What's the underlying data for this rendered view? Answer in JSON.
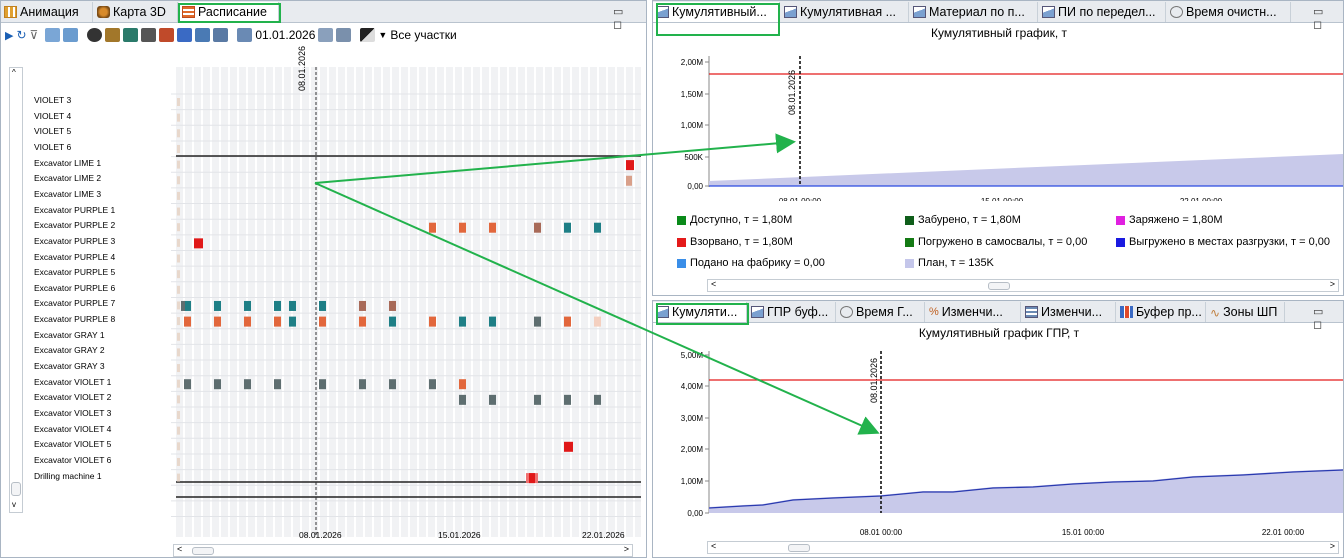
{
  "left_pane": {
    "tabs": [
      {
        "label": "Анимация",
        "icon": "animation-icon"
      },
      {
        "label": "Карта 3D",
        "icon": "map-3d-icon"
      },
      {
        "label": "Расписание",
        "icon": "schedule-icon"
      }
    ],
    "toolbar": {
      "date": "01.01.2026",
      "area_select": "Все участки"
    },
    "rows": [
      "VIOLET 3",
      "VIOLET 4",
      "VIOLET 5",
      "VIOLET 6",
      "Excavator LIME 1",
      "Excavator LIME 2",
      "Excavator LIME 3",
      "Excavator PURPLE 1",
      "Excavator PURPLE 2",
      "Excavator PURPLE 3",
      "Excavator PURPLE 4",
      "Excavator PURPLE 5",
      "Excavator PURPLE 6",
      "Excavator PURPLE 7",
      "Excavator PURPLE 8",
      "Excavator GRAY 1",
      "Excavator GRAY 2",
      "Excavator GRAY 3",
      "Excavator VIOLET 1",
      "Excavator VIOLET  2",
      "Excavator VIOLET  3",
      "Excavator VIOLET  4",
      "Excavator VIOLET  5",
      "Excavator VIOLET  6",
      "Drilling machine 1"
    ],
    "marker_date": "08.01.2026",
    "x_ticks": [
      "08.01.2026",
      "15.01.2026",
      "22.01.2026"
    ]
  },
  "top_right": {
    "tabs": [
      {
        "label": "Кумулятивный...",
        "icon": "area-chart-icon"
      },
      {
        "label": "Кумулятивная ...",
        "icon": "area-chart-icon"
      },
      {
        "label": "Материал по п...",
        "icon": "area-chart-icon"
      },
      {
        "label": "ПИ по передел...",
        "icon": "area-chart-icon"
      },
      {
        "label": "Время очистн...",
        "icon": "gauge-icon"
      }
    ],
    "title": "Кумулятивный график, т",
    "marker_date": "08.01.2026",
    "y_ticks": [
      "2,00M",
      "1,50M",
      "1,00M",
      "500K",
      "0,00"
    ],
    "x_ticks": [
      "08.01 00:00",
      "15.01 00:00",
      "22.01 00:00"
    ],
    "legend": [
      {
        "label": "Доступно, т = 1,80M",
        "color": "#0a8a1a"
      },
      {
        "label": "Забурено, т = 1,80M",
        "color": "#0f5e1a"
      },
      {
        "label": "Заряжено = 1,80M",
        "color": "#e020e0"
      },
      {
        "label": "Взорвано, т = 1,80M",
        "color": "#e41a1a"
      },
      {
        "label": "Погружено в самосвалы, т = 0,00",
        "color": "#147a14"
      },
      {
        "label": "Выгружено в местах разгрузки, т = 0,00",
        "color": "#1a1ae0"
      },
      {
        "label": "Подано на фабрику = 0,00",
        "color": "#3a8ee8"
      },
      {
        "label": "План, т = 135K",
        "color": "#c4c6ea"
      }
    ]
  },
  "bottom_right": {
    "tabs": [
      {
        "label": "Кумуляти...",
        "icon": "area-chart-icon"
      },
      {
        "label": "ГПР буф...",
        "icon": "area-chart-icon"
      },
      {
        "label": "Время Г...",
        "icon": "gauge-icon"
      },
      {
        "label": "Изменчи...",
        "icon": "percent-icon"
      },
      {
        "label": "Изменчи...",
        "icon": "table-icon"
      },
      {
        "label": "Буфер пр...",
        "icon": "bar-chart-icon"
      },
      {
        "label": "Зоны ШП",
        "icon": "line-icon"
      }
    ],
    "title": "Кумулятивный график ГПР, т",
    "marker_date": "08.01.2026",
    "y_ticks": [
      "5,00M",
      "4,00M",
      "3,00M",
      "2,00M",
      "1,00M",
      "0,00"
    ],
    "x_ticks": [
      "08.01 00:00",
      "15.01 00:00",
      "22.01 00:00"
    ]
  }
}
